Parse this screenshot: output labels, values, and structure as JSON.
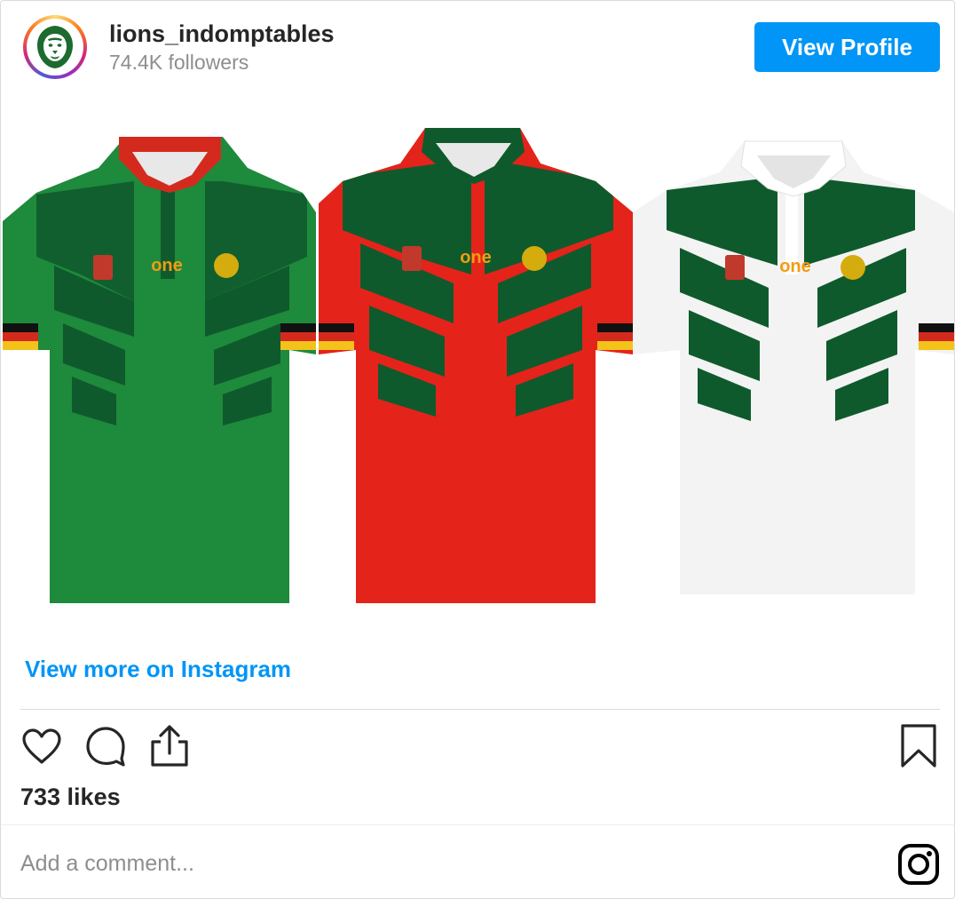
{
  "header": {
    "username": "lions_indomptables",
    "followers": "74.4K followers",
    "view_profile_label": "View Profile"
  },
  "media": {
    "jerseys": [
      {
        "name": "green-home",
        "logo_text": "one",
        "base": "#1e8a3c",
        "accent": "#d42a1e",
        "stripe": "#0f5a2c"
      },
      {
        "name": "red-away",
        "logo_text": "one",
        "base": "#e4231b",
        "accent": "#0f5a2c",
        "stripe": "#0f5a2c"
      },
      {
        "name": "white-third",
        "logo_text": "one",
        "base": "#f3f3f3",
        "accent": "#ffffff",
        "stripe": "#0f5a2c"
      }
    ]
  },
  "view_more_label": "View more on Instagram",
  "actions": {
    "like_icon": "heart-icon",
    "comment_icon": "comment-icon",
    "share_icon": "share-icon",
    "save_icon": "bookmark-icon"
  },
  "likes": "733 likes",
  "comment_placeholder": "Add a comment...",
  "footer_icon": "instagram-icon",
  "colors": {
    "primary_button": "#0095f6",
    "link": "#0095f6",
    "text": "#262626",
    "muted": "#8e8e8e",
    "divider": "#dbdbdb"
  }
}
